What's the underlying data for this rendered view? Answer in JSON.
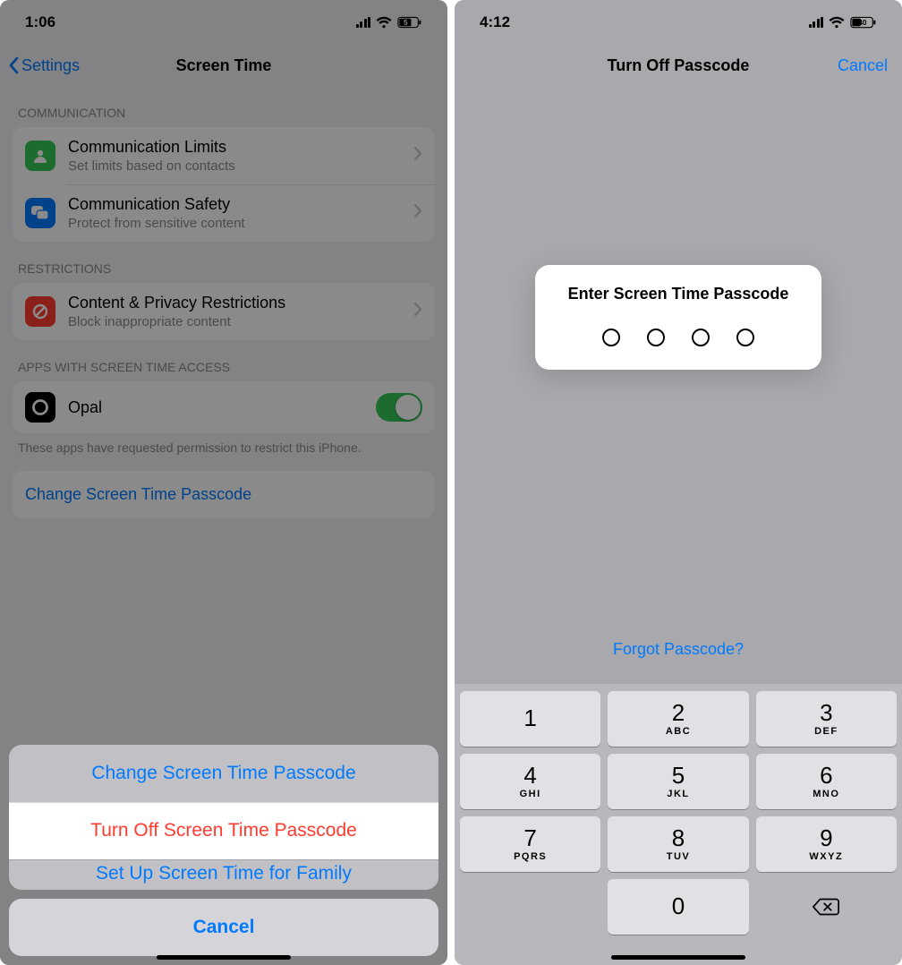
{
  "left": {
    "status": {
      "time": "1:06",
      "battery": "5"
    },
    "nav": {
      "back": "Settings",
      "title": "Screen Time"
    },
    "sections": {
      "comm_header": "COMMUNICATION",
      "comm_limits": {
        "title": "Communication Limits",
        "sub": "Set limits based on contacts"
      },
      "comm_safety": {
        "title": "Communication Safety",
        "sub": "Protect from sensitive content"
      },
      "restr_header": "RESTRICTIONS",
      "content_priv": {
        "title": "Content & Privacy Restrictions",
        "sub": "Block inappropriate content"
      },
      "apps_header": "APPS WITH SCREEN TIME ACCESS",
      "opal": {
        "title": "Opal"
      },
      "apps_footer": "These apps have requested permission to restrict this iPhone.",
      "change_link": "Change Screen Time Passcode"
    },
    "sheet": {
      "change": "Change Screen Time Passcode",
      "turn_off": "Turn Off Screen Time Passcode",
      "setup_peek": "Set Up Screen Time for Family",
      "cancel": "Cancel"
    }
  },
  "right": {
    "status": {
      "time": "4:12",
      "battery": "40"
    },
    "nav": {
      "title": "Turn Off Passcode",
      "cancel": "Cancel"
    },
    "prompt": "Enter Screen Time Passcode",
    "forgot": "Forgot Passcode?",
    "keypad": [
      {
        "n": "1",
        "l": ""
      },
      {
        "n": "2",
        "l": "ABC"
      },
      {
        "n": "3",
        "l": "DEF"
      },
      {
        "n": "4",
        "l": "GHI"
      },
      {
        "n": "5",
        "l": "JKL"
      },
      {
        "n": "6",
        "l": "MNO"
      },
      {
        "n": "7",
        "l": "PQRS"
      },
      {
        "n": "8",
        "l": "TUV"
      },
      {
        "n": "9",
        "l": "WXYZ"
      },
      {
        "n": "0",
        "l": ""
      }
    ]
  }
}
